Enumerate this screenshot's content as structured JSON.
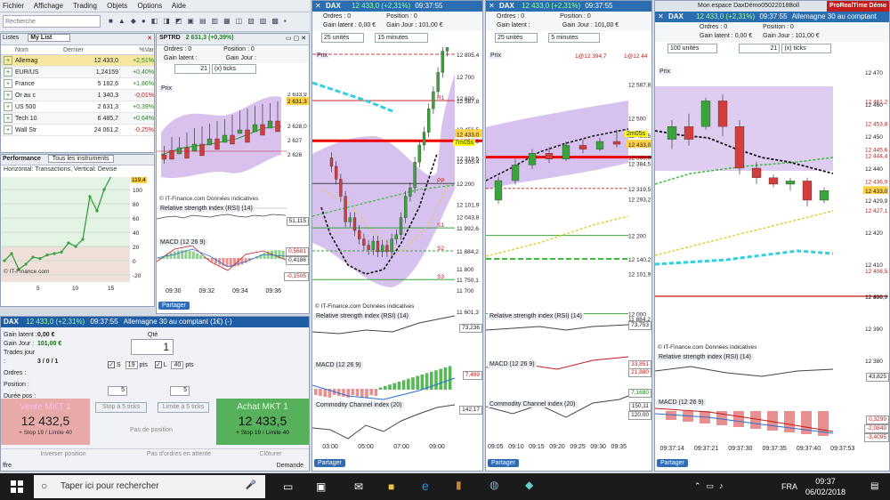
{
  "menu": [
    "Fichier",
    "Affichage",
    "Trading",
    "Objets",
    "Options",
    "Aide"
  ],
  "search_placeholder": "Recherche",
  "lists": {
    "tab1": "Listes",
    "tab2": "My List",
    "cols": [
      "Nom",
      "Dernier",
      "%Var"
    ],
    "rows": [
      {
        "name": "Allemag",
        "last": "12 433,0",
        "var": "+2,51%",
        "color": "#1a8a1a"
      },
      {
        "name": "EUR/US",
        "last": "1,24159",
        "var": "+0,40%",
        "color": "#1a8a1a"
      },
      {
        "name": "France",
        "last": "5 182,6",
        "var": "+1,86%",
        "color": "#1a8a1a"
      },
      {
        "name": "Or au c",
        "last": "1 340,3",
        "var": "-0,01%",
        "color": "#c41a1a"
      },
      {
        "name": "US 500",
        "last": "2 631,3",
        "var": "+0,39%",
        "color": "#1a8a1a"
      },
      {
        "name": "Tech 10",
        "last": "6 485,7",
        "var": "+0,64%",
        "color": "#1a8a1a"
      },
      {
        "name": "Wall Str",
        "last": "24 061,2",
        "var": "-0,25%",
        "color": "#c41a1a"
      }
    ]
  },
  "perf": {
    "title": "Performance",
    "tab": "Tous les instruments",
    "subtitle": "Horizontal: Transactions, Vertical: Devise",
    "yticks": [
      "100",
      "80",
      "60",
      "40",
      "20",
      "0",
      "-20"
    ],
    "xticks": [
      "5",
      "10",
      "15"
    ],
    "last_value": "119,4",
    "credit": "© IT-Finance.com",
    "points": [
      0,
      10,
      -12,
      -5,
      5,
      3,
      8,
      10,
      12,
      25,
      20,
      30,
      90,
      70,
      100,
      119
    ]
  },
  "sptrd": {
    "title": "SPTRD",
    "price": "2 631,3 (+0,39%)",
    "orders": "Ordres : 0",
    "position": "Position : 0",
    "gain_latent": "Gain latent :",
    "gain_jour": "Gain Jour :",
    "period": "21",
    "unit": "(x) ticks",
    "prix": "Prix",
    "yticks": [
      "2 633,9",
      "2 631,3",
      "2 628,0",
      "2 627",
      "2 626"
    ],
    "rsi": "Relative strength index (RSI) (14)",
    "rsi_val": "51,115",
    "macd": "MACD (12 26 9)",
    "macd_vals": [
      "0,5681",
      "0,4186",
      "-0,1505"
    ],
    "credit": "© IT-Finance.com Données indicatives",
    "xticks": [
      "09:30",
      "09:32",
      "09:34",
      "09:36"
    ],
    "partager": "Partager"
  },
  "dax_trade": {
    "title": "DAX",
    "price": "12 433,0 (+2,31%)",
    "desc": "Allemagne 30 au comptant (1€) (-)",
    "time": "09:37:55",
    "gain_latent_label": "Gain latent :",
    "gain_latent": "0,00 €",
    "gain_jour_label": "Gain Jour :",
    "gain_jour": "101,00 €",
    "trades_label": "Trades jour :",
    "trades": "3 / 0 / 1",
    "orders_label": "Ordres :",
    "position_label": "Position :",
    "duree_label": "Durée pos :",
    "qty_label": "Qté",
    "qty": "1",
    "s_label": "S",
    "s_val": "19",
    "l_label": "L",
    "l_val": "40",
    "pts": "pts",
    "step1": "5",
    "step2": "5",
    "stop_btn": "Stop à 5 ticks",
    "limit_btn": "Limite à 5 ticks",
    "sell_label": "Vente MKT 1",
    "sell_price": "12 432,5",
    "sell_sub": "+ Stop 19 / Limite 40",
    "no_position": "Pas de position",
    "buy_label": "Achat MKT 1",
    "buy_price": "12 433,5",
    "buy_sub": "+ Stop 19 / Limite 40",
    "invert": "Inverser position",
    "no_orders": "Pas d'ordres en attente",
    "close": "Clôturer",
    "offre": "ffre",
    "demande": "Demande"
  },
  "chart1": {
    "title": "DAX",
    "price": "12 433,0 (+2,31%)",
    "time": "09:37:55",
    "orders": "Ordres : 0",
    "position": "Position : 0",
    "gain_latent": "Gain latent : 0,00 €",
    "gain_jour": "Gain Jour : 101,00 €",
    "units": "25 unités",
    "interval": "15 minutes",
    "prix": "Prix",
    "yticks": [
      "12 805,4",
      "12 700",
      "12 600",
      "12 587,8",
      "12 456,5",
      "12 433,0",
      "12 399,9",
      "12 319,5",
      "12 305,4",
      "12 200",
      "12 101,9",
      "12 043,8",
      "11 992,6",
      "11 884,2",
      "11 800",
      "11 750,1",
      "11 700",
      "11 601,3"
    ],
    "levels": [
      "R1",
      "PP",
      "S1",
      "S2",
      "S3"
    ],
    "rsi": "Relative strength index (RSI) (14)",
    "rsi_val": "73,236",
    "macd": "MACD (12 26 9)",
    "macd_vals": [
      "7,499"
    ],
    "cci": "Commodity Channel index (20)",
    "cci_val": "142,17",
    "xticks": [
      "03:00",
      "05:00",
      "07:00",
      "09:00"
    ],
    "credit": "© IT-Finance.com Données indicatives",
    "partager": "Partager",
    "countdown": "7m05s"
  },
  "chart2": {
    "title": "DAX",
    "price": "12 433,0 (+2,31%)",
    "time": "09:37:55",
    "orders": "Ordres : 0",
    "position": "Position : 0",
    "gain_latent": "Gain latent :",
    "gain_jour": "Gain Jour : 101,00 €",
    "units": "25 unités",
    "interval": "5 minutes",
    "prix": "Prix",
    "tag_a": "1@12 394,7",
    "tag_b": "1@12 44",
    "yticks": [
      "12 587,8",
      "12 500",
      "12 456,5",
      "12 433,0",
      "12 399,9",
      "12 384,5",
      "12 319,5",
      "12 293,2",
      "12 200",
      "12 140,2",
      "12 101,9",
      "12 000",
      "11 884,2"
    ],
    "rsi": "Relative strength index (RSI) (14)",
    "rsi_val": "73,753",
    "macd": "MACD (12 26 9)",
    "macd_vals": [
      "33,851",
      "21,880",
      "7,1680"
    ],
    "cci": "Commodity Channel index (20)",
    "cci_vals": [
      "150,11",
      "120,00"
    ],
    "xticks": [
      "09:05",
      "09:10",
      "09:15",
      "09:20",
      "09:25",
      "09:30",
      "09:35"
    ],
    "countdown": "2m05s",
    "partager": "Partager"
  },
  "chart3": {
    "title": "DAX",
    "price": "12 433,0 (+2,31%)",
    "desc": "Allemagne 30 au comptant",
    "time": "09:37:55",
    "workspace": "Mon espace DaxDémo05022018Boll",
    "brand": "ProRealTime Démo",
    "orders": "Ordres : 0",
    "position": "Position : 0",
    "gain_latent": "Gain latent : 0,00 €",
    "gain_jour": "Gain Jour : 101,00 €",
    "units": "100 unités",
    "period": "21",
    "unit": "(x) ticks",
    "prix": "Prix",
    "yticks": [
      "12 470",
      "12 461,2",
      "12 460",
      "12 453,8",
      "12 450",
      "12 445,6",
      "12 444,4",
      "12 440",
      "12 436,0",
      "12 433,0",
      "12 429,9",
      "12 427,1",
      "12 420",
      "12 410",
      "12 408,5",
      "12 400",
      "12 399,9",
      "12 390",
      "12 380"
    ],
    "rsi": "Relative strength index (RSI) (14)",
    "rsi_val": "43,825",
    "macd": "MACD (12 26 9)",
    "macd_vals": [
      "0,3299",
      "-2,0849",
      "-3,4095"
    ],
    "xticks": [
      "09:37:14",
      "09:37:21",
      "09:37:30",
      "09:37:35",
      "09:37:40",
      "09:37:53"
    ],
    "credit": "© IT-Finance.com Données indicatives",
    "partager": "Partager"
  },
  "taskbar": {
    "search": "Taper ici pour rechercher",
    "lang": "FRA",
    "time": "09:37",
    "date": "06/02/2018"
  }
}
